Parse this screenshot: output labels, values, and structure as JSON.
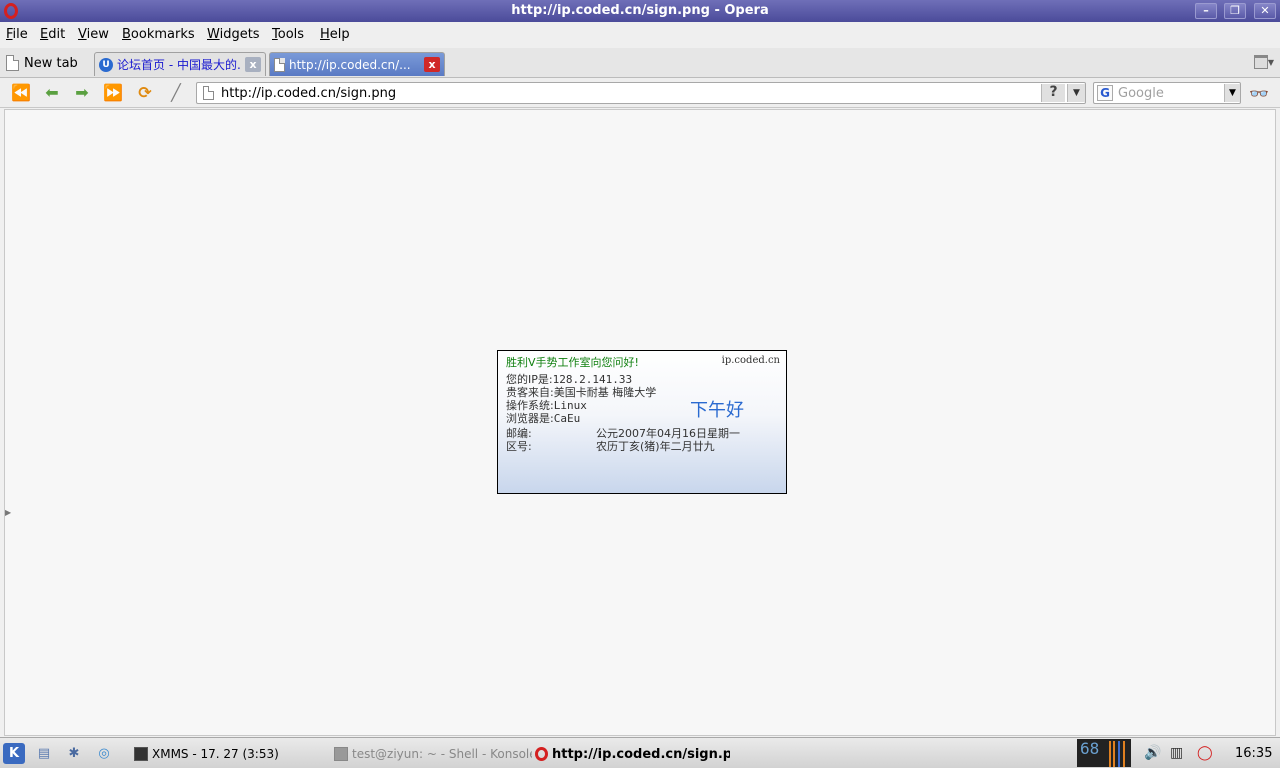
{
  "window": {
    "title": "http://ip.coded.cn/sign.png - Opera",
    "minimize": "–",
    "maximize": "❐",
    "close": "✕"
  },
  "menu": {
    "items": [
      {
        "first": "F",
        "rest": "ile"
      },
      {
        "first": "E",
        "rest": "dit"
      },
      {
        "first": "V",
        "rest": "iew"
      },
      {
        "first": "B",
        "rest": "ookmarks"
      },
      {
        "first": "W",
        "rest": "idgets"
      },
      {
        "first": "T",
        "rest": "ools"
      },
      {
        "first": "H",
        "rest": "elp"
      }
    ]
  },
  "tabs": {
    "new_tab_label": "New tab",
    "items": [
      {
        "label": "论坛首页 - 中国最大的...",
        "close": "x",
        "active": false
      },
      {
        "label": "http://ip.coded.cn/...",
        "close": "x",
        "active": true
      }
    ]
  },
  "toolbar": {
    "url": "http://ip.coded.cn/sign.png",
    "help": "?",
    "dropdown": "▼",
    "search_placeholder": "Google",
    "search_engine_icon": "G"
  },
  "sign": {
    "greeting": "胜利V手势工作室向您问好!",
    "site": "ip.coded.cn",
    "ip_label": "您的IP是:",
    "ip_value": "128.2.141.33",
    "from_label": "贵客来自:",
    "from_value": "美国卡耐基  梅隆大学",
    "os_label": "操作系统:",
    "os_value": "Linux",
    "browser_label": "浏览器是:",
    "browser_value": "CaEu",
    "postcode_label": "邮编:",
    "areacode_label": "区号:",
    "afternoon": "下午好",
    "gregorian_date": "公元2007年04月16日星期一",
    "lunar_date": "农历丁亥(猪)年二月廿九"
  },
  "taskbar": {
    "tasks": [
      {
        "label": "XMMS - 17. 27 (3:53)"
      },
      {
        "label": "test@ziyun: ~ - Shell - Konsole"
      },
      {
        "label": "http://ip.coded.cn/sign.png - Opera"
      }
    ],
    "monitor": "68",
    "clock": "16:35"
  }
}
